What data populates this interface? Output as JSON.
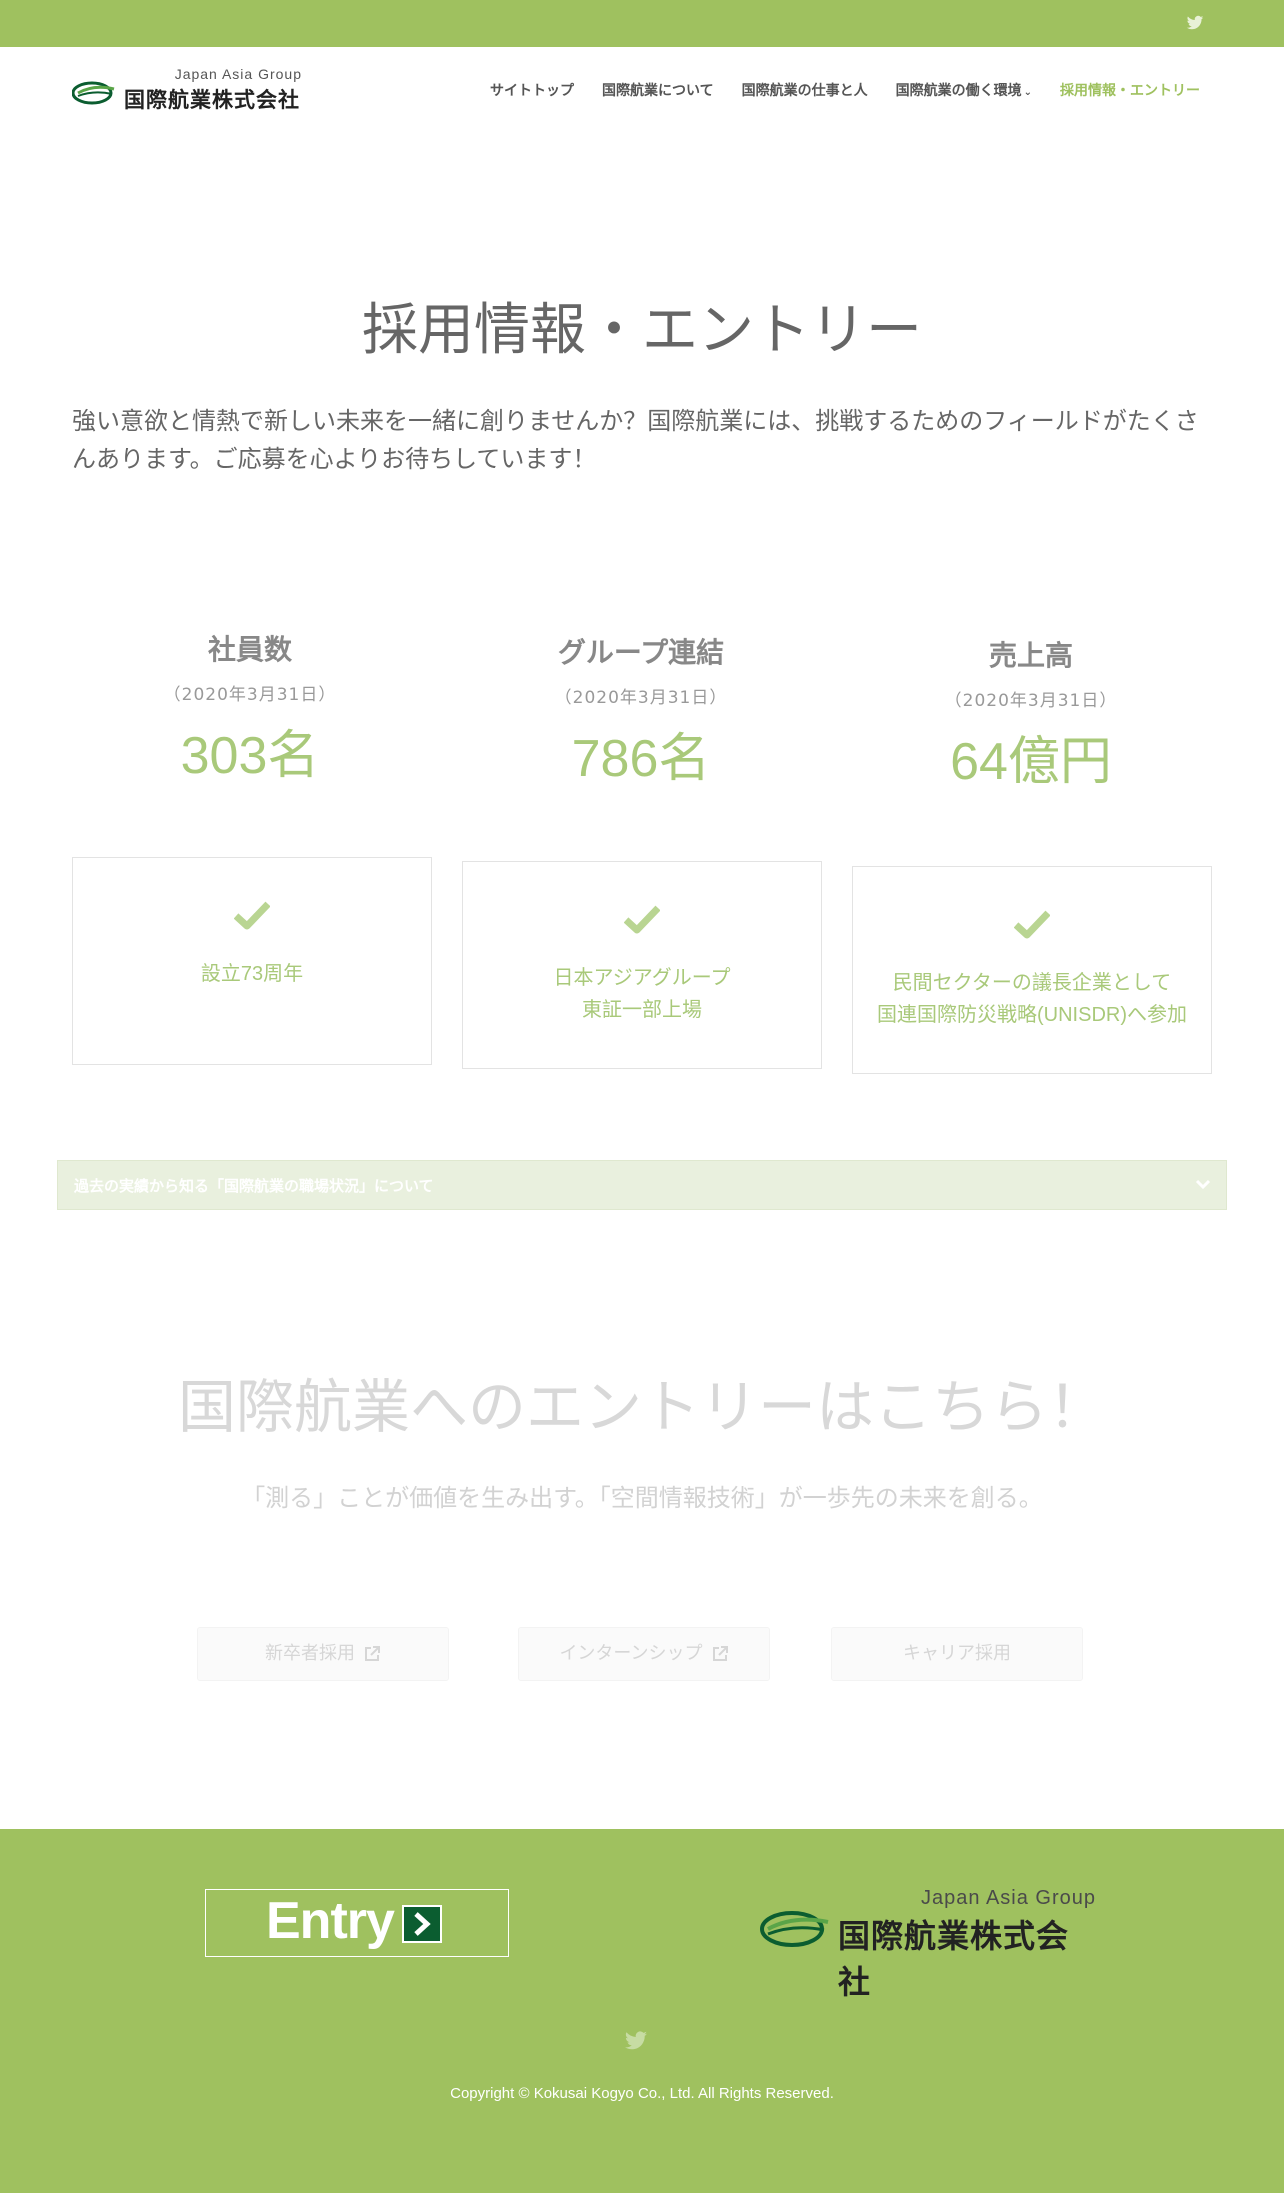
{
  "header": {
    "logo_group": "Japan Asia Group",
    "logo_name": "国際航業株式会社",
    "nav": [
      {
        "label": "サイトトップ"
      },
      {
        "label": "国際航業について"
      },
      {
        "label": "国際航業の仕事と人"
      },
      {
        "label": "国際航業の働く環境",
        "caret": "⌄"
      },
      {
        "label": "採用情報・エントリー"
      }
    ]
  },
  "main": {
    "title": "採用情報・エントリー",
    "intro": "強い意欲と情熱で新しい未来を一緒に創りませんか？国際航業には、挑戦するためのフィールドがたくさんあります。ご応募を心よりお待ちしています！",
    "stats": [
      {
        "label": "社員数",
        "date": "（2020年3月31日）",
        "value": "303名"
      },
      {
        "label": "グループ連結",
        "date": "（2020年3月31日）",
        "value": "786名"
      },
      {
        "label": "売上高",
        "date": "（2020年3月31日）",
        "value": "64億円"
      }
    ],
    "features": [
      {
        "line1": "設立73周年",
        "line2": ""
      },
      {
        "line1": "日本アジアグループ",
        "line2": "東証一部上場"
      },
      {
        "line1": "民間セクターの議長企業として",
        "line2": "国連国際防災戦略(UNISDR)へ参加"
      }
    ],
    "accordion_label": "過去の実績から知る「国際航業の職場状況」について"
  },
  "entry": {
    "title": "国際航業へのエントリーはこちら！",
    "subtitle": "「測る」ことが価値を生み出す。「空間情報技術」が一歩先の未来を創る。",
    "buttons": {
      "new_grad": "新卒者採用",
      "internship": "インターンシップ",
      "career": "キャリア採用"
    }
  },
  "footer": {
    "entry_label": "Entry",
    "logo_group": "Japan Asia Group",
    "logo_name": "国際航業株式会社",
    "copyright": "Copyright © Kokusai Kogyo Co., Ltd. All Rights Reserved."
  },
  "colors": {
    "brand_green": "#9fc15f",
    "light_green_text": "#a9c97a",
    "logo_dark_green": "#0b5d30"
  }
}
